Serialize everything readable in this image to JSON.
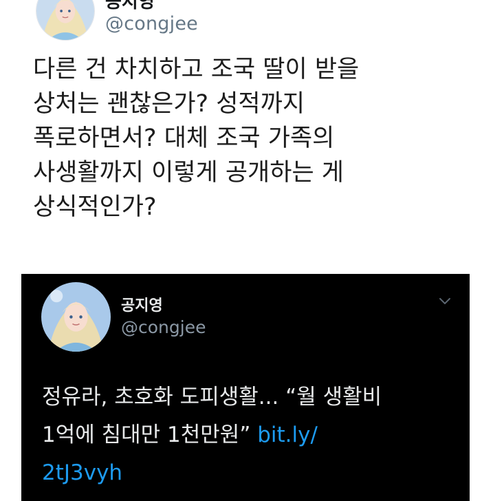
{
  "tweet": {
    "display_name": "공지영",
    "handle": "@congjee",
    "text_lines": [
      "다른 건 차치하고 조국 딸이 받을",
      "상처는 괜찮은가? 성적까지",
      "폭로하면서? 대체 조국 가족의",
      "사생활까지 이렇게 공개하는 게",
      "상식적인가?"
    ]
  },
  "quoted_tweet": {
    "display_name": "공지영",
    "handle": "@congjee",
    "text_line1": "정유라, 초호화 도피생활... “월 생활비",
    "text_line2": "1억에 침대만 1천만원”",
    "link_part1": "bit.ly/",
    "link_part2": "2tJ3vyh",
    "menu_icon": "chevron-down-icon",
    "theme": "dark"
  },
  "colors": {
    "top_background": "#ffffff",
    "quoted_background": "#000000",
    "link": "#1d9bf0",
    "handle_light": "#657786",
    "handle_dark": "#8b98a5"
  }
}
